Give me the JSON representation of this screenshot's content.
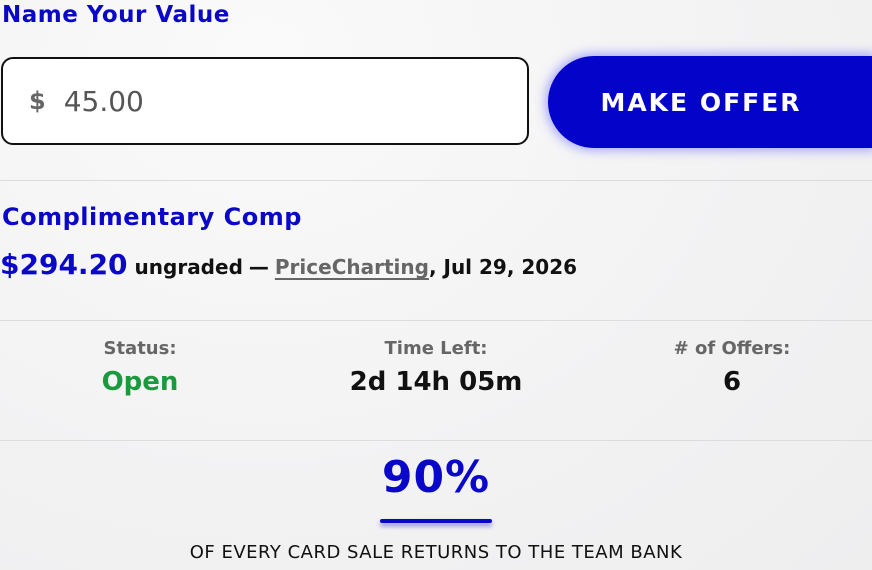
{
  "offer": {
    "title": "Name Your Value",
    "currency_symbol": "$",
    "input_value": "45.00",
    "button_label": "MAKE OFFER"
  },
  "comp": {
    "title": "Complimentary Comp",
    "price": "$294.20",
    "grade": "ungraded",
    "separator": "—",
    "source": "PriceCharting",
    "date": ", Jul 29, 2026"
  },
  "stats": {
    "status_label": "Status:",
    "status_value": "Open",
    "time_label": "Time Left:",
    "time_value": "2d 14h 05m",
    "offers_label": "# of Offers:",
    "offers_value": "6"
  },
  "bank": {
    "percent": "90%",
    "caption": "OF EVERY CARD SALE RETURNS TO THE TEAM BANK"
  },
  "colors": {
    "brand_blue": "#0a07c8",
    "button_blue": "#0303c9",
    "status_open_green": "#1a9a3d",
    "muted_text": "#666666"
  }
}
